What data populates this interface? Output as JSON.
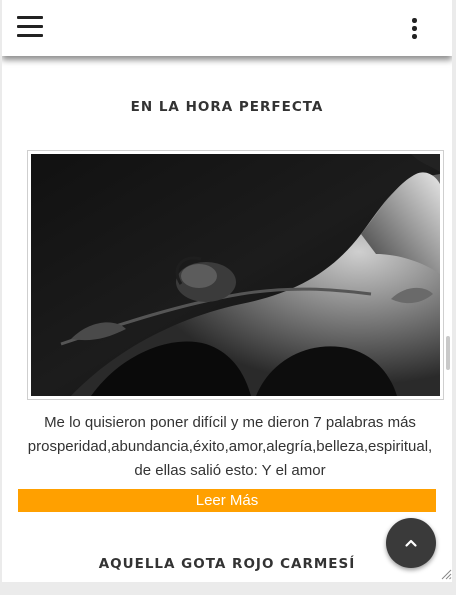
{
  "header": {
    "menu_icon": "hamburger-menu-icon",
    "more_icon": "vertical-dots-icon"
  },
  "post": {
    "title": "EN LA HORA PERFECTA",
    "image_description_icon": "photo-rose-on-body",
    "excerpt_line1": "Me lo quisieron poner difícil y me dieron 7 palabras más",
    "excerpt_line2": "prosperidad,abundancia,éxito,amor,alegría,belleza,espiritual,",
    "excerpt_line3": "de ellas salió esto:   Y el amor",
    "read_more_label": "Leer Más"
  },
  "next_post": {
    "title": "AQUELLA GOTA ROJO CARMESÍ"
  },
  "back_to_top": {
    "icon": "chevron-up-icon",
    "glyph": "⌃"
  },
  "colors": {
    "accent": "#ffa000",
    "text": "#333333",
    "button_dark": "#3a3a3a"
  }
}
